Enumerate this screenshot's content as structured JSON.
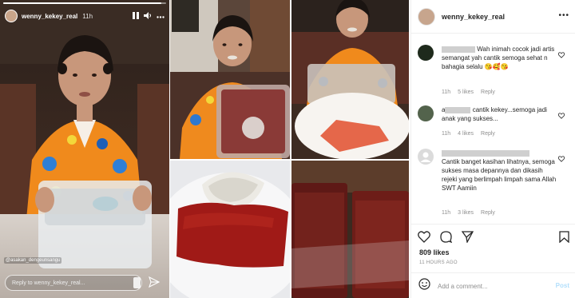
{
  "story": {
    "username": "wenny_kekey_real",
    "time": "11h",
    "progress": 0.97,
    "mention": "@asakan_dengeunsangu",
    "reply_placeholder": "Reply to wenny_kekey_real...",
    "pause_icon": "pause-icon",
    "mute_icon": "speaker-icon",
    "more_icon": "more-icon",
    "send_icon": "send-icon"
  },
  "post": {
    "username": "wenny_kekey_real",
    "likes": "809 likes",
    "time_ago": "11 HOURS AGO",
    "add_comment_placeholder": "Add a comment...",
    "post_label": "Post",
    "accent": "#0095f6"
  },
  "comments": [
    {
      "text": "Wah inimah cocok jadi artis semangat yah cantik semoga sehat n bahagia selalu",
      "emoji": "😘🥰😘",
      "time": "11h",
      "likes": "5 likes",
      "reply": "Reply",
      "avatar_color": "#1e2a1c"
    },
    {
      "prefix": "a",
      "text": "cantik kekey...semoga jadi anak yang sukses...",
      "time": "11h",
      "likes": "4 likes",
      "reply": "Reply",
      "avatar_color": "#53634c"
    },
    {
      "text": "Cantik banget kasihan lihatnya, semoga sukses masa depannya dan dikasih rejeki yang berlimpah limpah sama Allah SWT Aamiin",
      "time": "11h",
      "likes": "3 likes",
      "reply": "Reply",
      "avatar_color": "#dbdbdb"
    }
  ]
}
